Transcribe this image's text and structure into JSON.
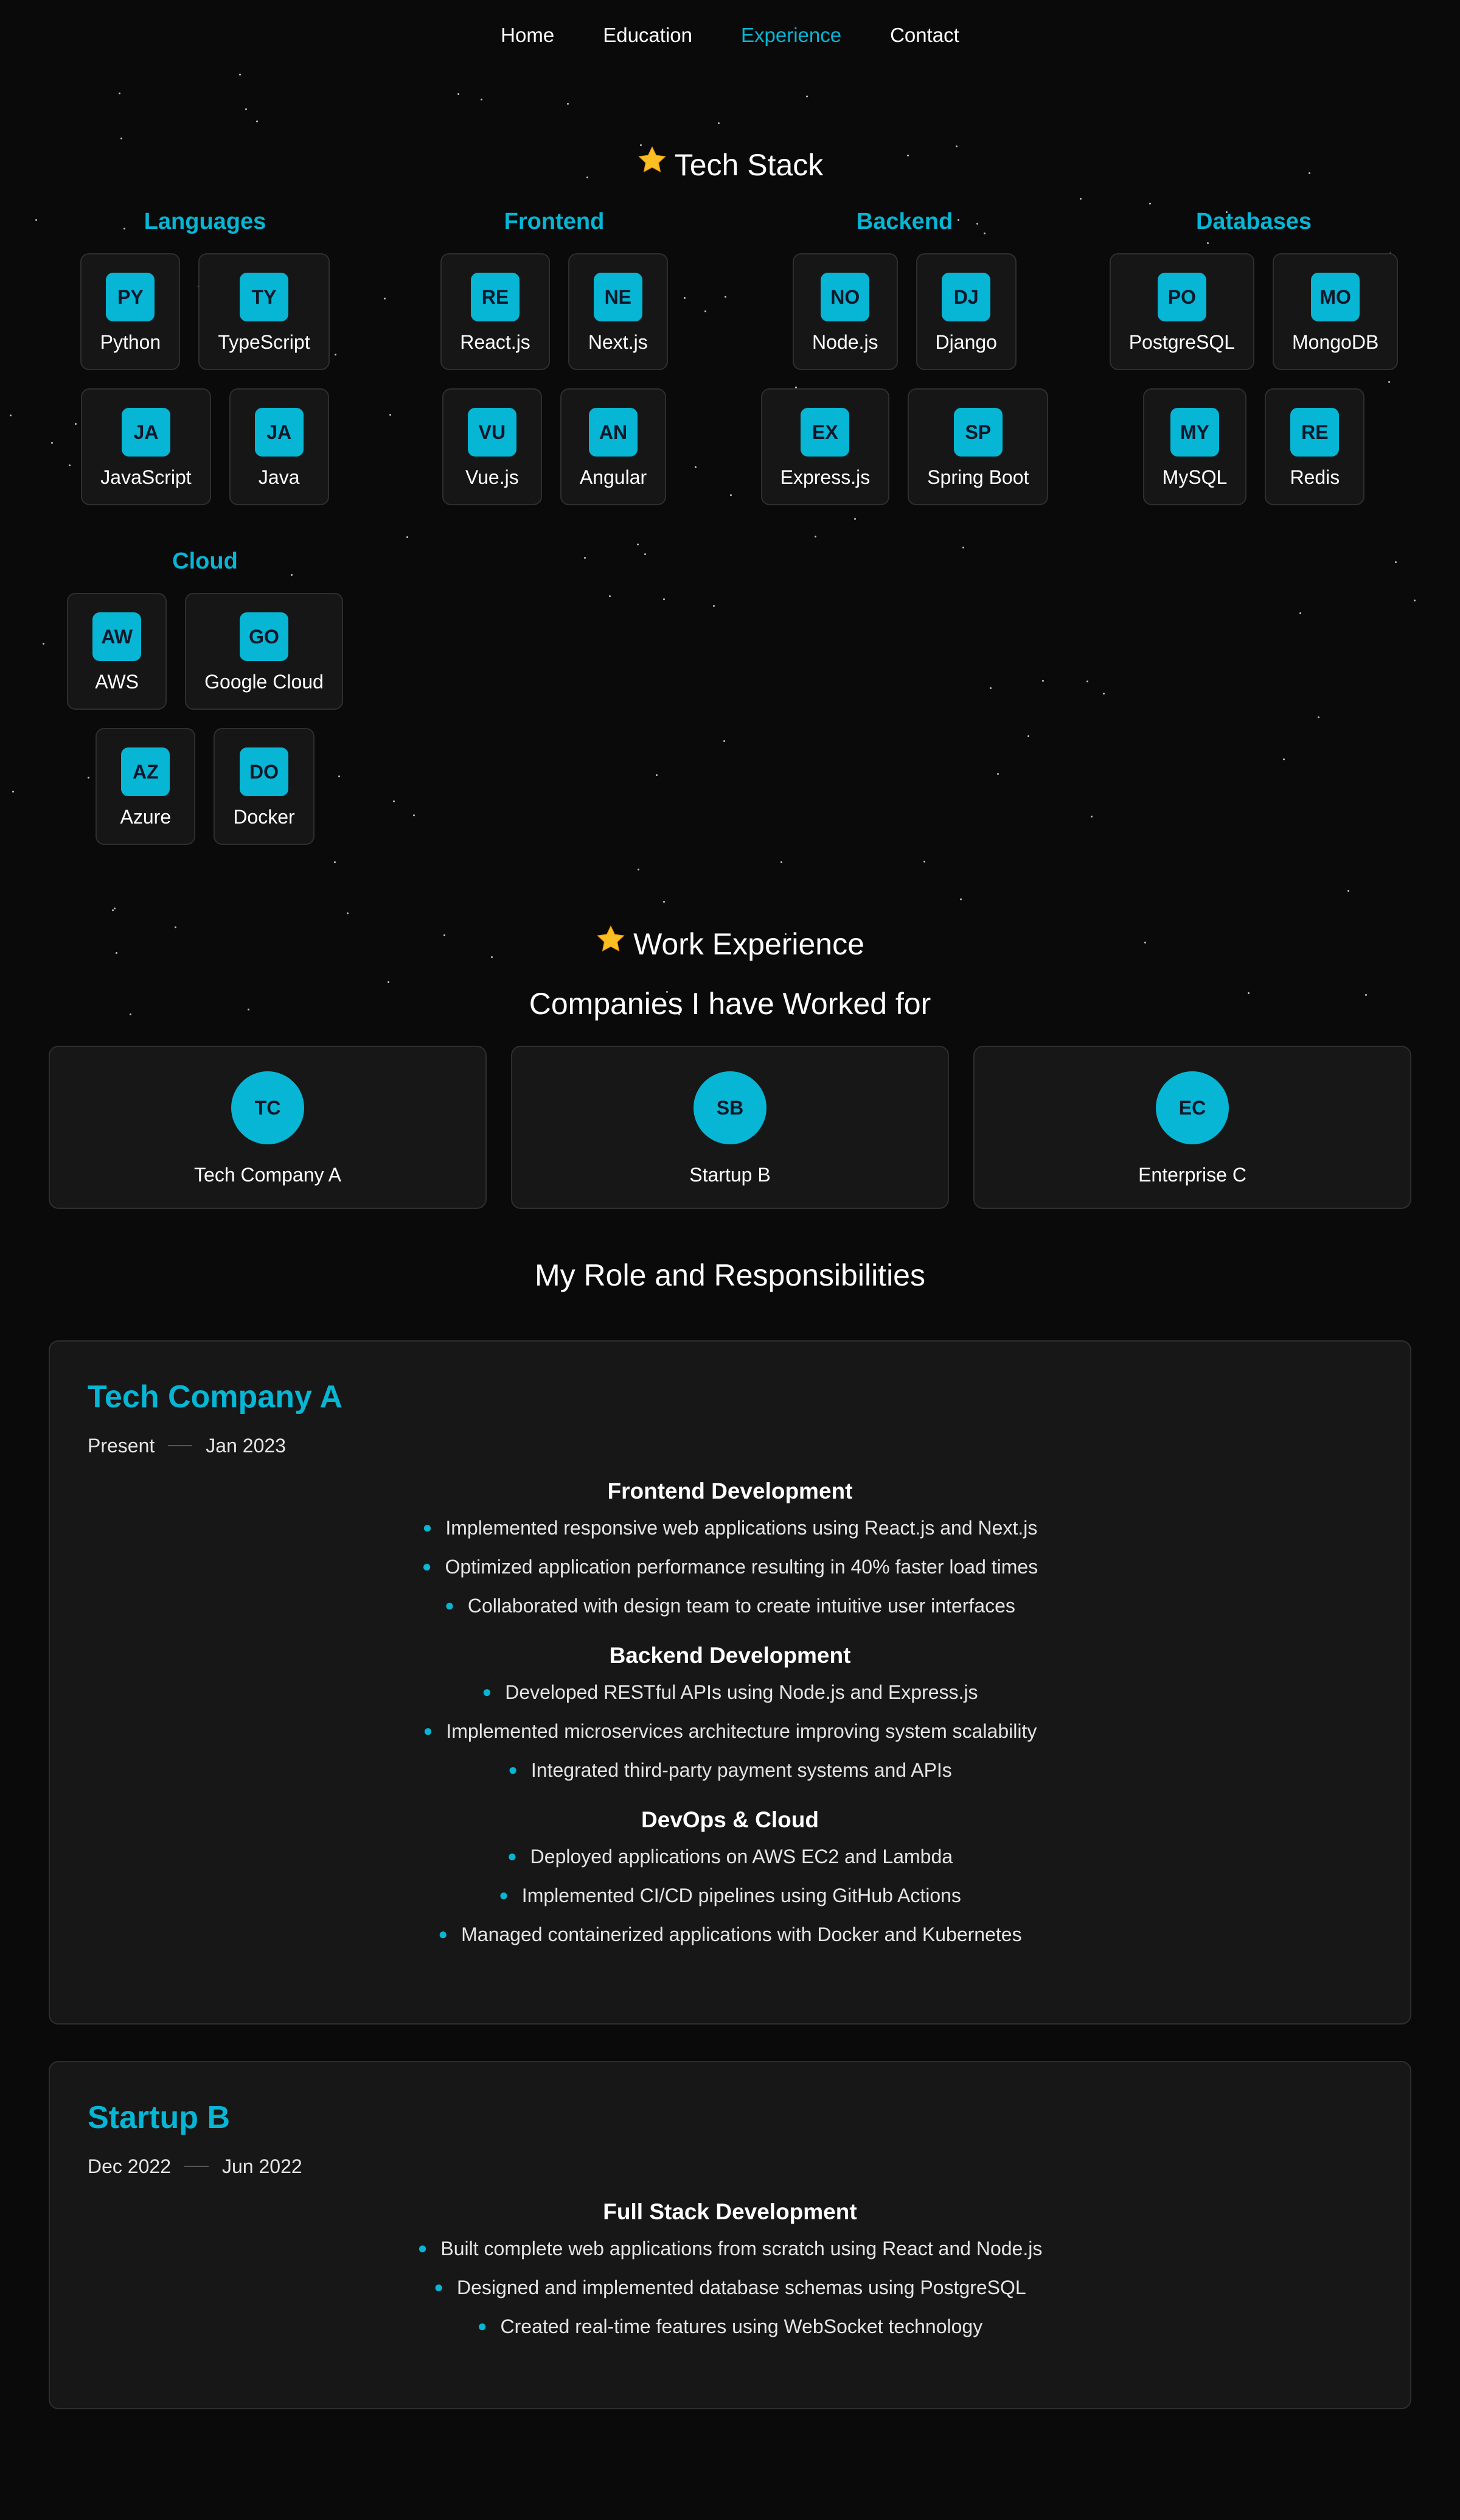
{
  "nav": {
    "items": [
      {
        "label": "Home",
        "active": false
      },
      {
        "label": "Education",
        "active": false
      },
      {
        "label": "Experience",
        "active": true
      },
      {
        "label": "Contact",
        "active": false
      }
    ]
  },
  "colors": {
    "accent": "#06b6d4",
    "background": "#0a0a0a",
    "card": "#171717"
  },
  "tech_stack": {
    "title": "Tech Stack",
    "icon": "star-icon",
    "groups": [
      {
        "title": "Languages",
        "items": [
          {
            "code": "PY",
            "label": "Python"
          },
          {
            "code": "TY",
            "label": "TypeScript"
          },
          {
            "code": "JA",
            "label": "JavaScript"
          },
          {
            "code": "JA",
            "label": "Java"
          }
        ]
      },
      {
        "title": "Frontend",
        "items": [
          {
            "code": "RE",
            "label": "React.js"
          },
          {
            "code": "NE",
            "label": "Next.js"
          },
          {
            "code": "VU",
            "label": "Vue.js"
          },
          {
            "code": "AN",
            "label": "Angular"
          }
        ]
      },
      {
        "title": "Backend",
        "items": [
          {
            "code": "NO",
            "label": "Node.js"
          },
          {
            "code": "DJ",
            "label": "Django"
          },
          {
            "code": "EX",
            "label": "Express.js"
          },
          {
            "code": "SP",
            "label": "Spring Boot"
          }
        ]
      },
      {
        "title": "Databases",
        "items": [
          {
            "code": "PO",
            "label": "PostgreSQL"
          },
          {
            "code": "MO",
            "label": "MongoDB"
          },
          {
            "code": "MY",
            "label": "MySQL"
          },
          {
            "code": "RE",
            "label": "Redis"
          }
        ]
      },
      {
        "title": "Cloud",
        "items": [
          {
            "code": "AW",
            "label": "AWS"
          },
          {
            "code": "GO",
            "label": "Google Cloud"
          },
          {
            "code": "AZ",
            "label": "Azure"
          },
          {
            "code": "DO",
            "label": "Docker"
          }
        ]
      }
    ]
  },
  "work": {
    "title": "Work Experience",
    "icon": "star-icon",
    "companies_title": "Companies I have Worked for",
    "companies": [
      {
        "initials": "TC",
        "name": "Tech Company A"
      },
      {
        "initials": "SB",
        "name": "Startup B"
      },
      {
        "initials": "EC",
        "name": "Enterprise C"
      }
    ],
    "roles_title": "My Role and Responsibilities",
    "experiences": [
      {
        "company": "Tech Company A",
        "start": "Present",
        "end": "Jan 2023",
        "sections": [
          {
            "title": "Frontend Development",
            "items": [
              "Implemented responsive web applications using React.js and Next.js",
              "Optimized application performance resulting in 40% faster load times",
              "Collaborated with design team to create intuitive user interfaces"
            ]
          },
          {
            "title": "Backend Development",
            "items": [
              "Developed RESTful APIs using Node.js and Express.js",
              "Implemented microservices architecture improving system scalability",
              "Integrated third-party payment systems and APIs"
            ]
          },
          {
            "title": "DevOps & Cloud",
            "items": [
              "Deployed applications on AWS EC2 and Lambda",
              "Implemented CI/CD pipelines using GitHub Actions",
              "Managed containerized applications with Docker and Kubernetes"
            ]
          }
        ]
      },
      {
        "company": "Startup B",
        "start": "Dec 2022",
        "end": "Jun 2022",
        "sections": [
          {
            "title": "Full Stack Development",
            "items": [
              "Built complete web applications from scratch using React and Node.js",
              "Designed and implemented database schemas using PostgreSQL",
              "Created real-time features using WebSocket technology"
            ]
          }
        ]
      }
    ]
  }
}
